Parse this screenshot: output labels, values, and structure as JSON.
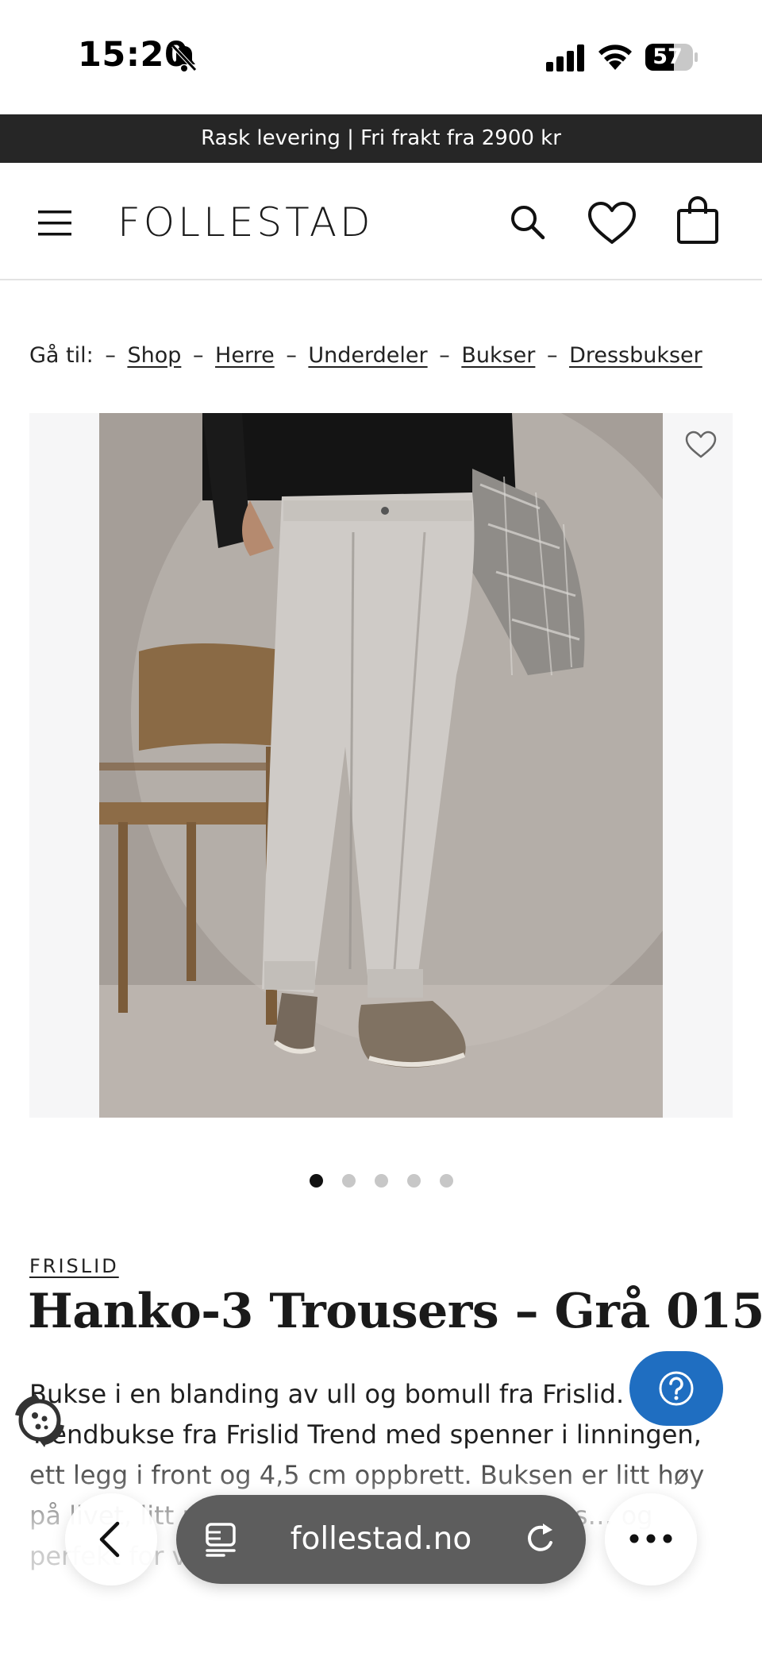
{
  "status_bar": {
    "time": "15:20",
    "battery": "57"
  },
  "promo": {
    "text": "Rask levering | Fri frakt fra 2900 kr"
  },
  "header": {
    "logo": "FOLLESTAD"
  },
  "breadcrumb": {
    "prefix": "Gå til:",
    "separator": "–",
    "items": [
      "Shop",
      "Herre",
      "Underdeler",
      "Bukser",
      "Dressbukser"
    ]
  },
  "gallery": {
    "image_count": 5,
    "active_index": 0
  },
  "product": {
    "brand": "FRISLID",
    "title": "Hanko-3 Trousers – Grå 015",
    "description": "Bukse i en blanding av ull og bomull fra Frislid. Trendbukse fra Frislid Trend med spenner i linningen, ett legg i front og 4,5 cm oppbrett. Buksen er litt høy på livet, litt mer vidde … effekt fantastisk, s… og perfekt for vår og sommer."
  },
  "browser": {
    "url": "follestad.no"
  },
  "icons": {
    "menu": "hamburger-menu-icon",
    "search": "search-icon",
    "wishlist": "heart-icon",
    "cart": "shopping-bag-icon",
    "help": "question-mark-icon",
    "cookie": "cookie-icon",
    "back": "chevron-left-icon",
    "tabs": "tabs-icon",
    "reload": "reload-icon",
    "more": "ellipsis-icon"
  },
  "colors": {
    "promo_bg": "#262626",
    "help_button": "#1f6ec1",
    "url_pill": "#5d5d5d",
    "dot_active": "#111111",
    "dot_inactive": "#c7c7c7"
  }
}
